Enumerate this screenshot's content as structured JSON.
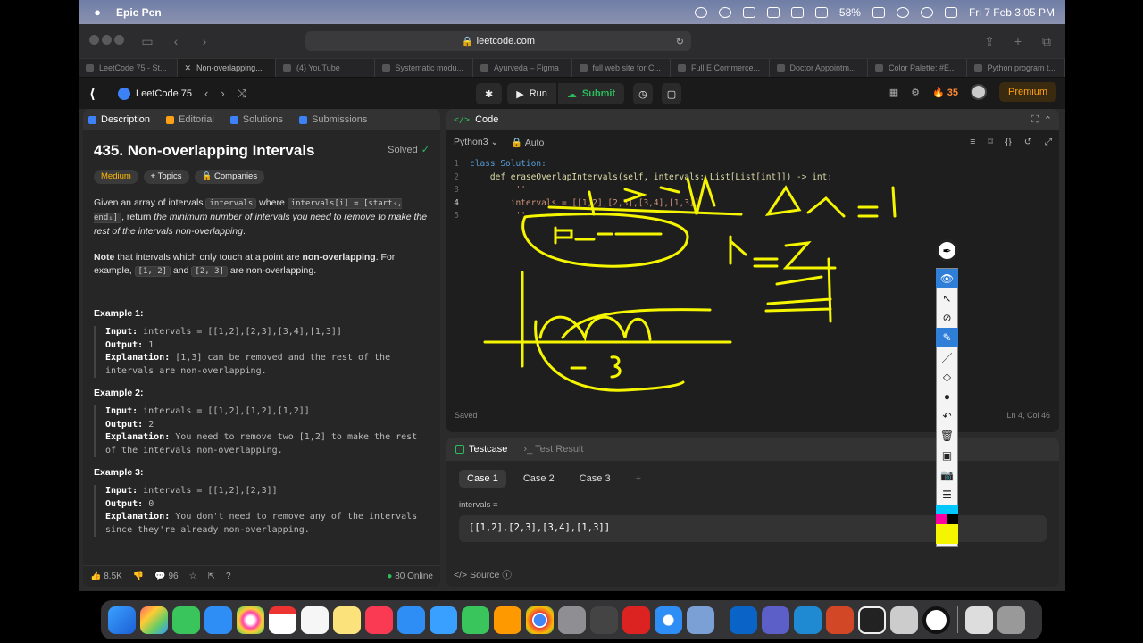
{
  "menubar": {
    "app": "Epic Pen",
    "battery": "58%",
    "clock": "Fri 7 Feb  3:05 PM"
  },
  "browser": {
    "url": "leetcode.com",
    "tabs": [
      "LeetCode 75 - St...",
      "Non-overlapping...",
      "(4) YouTube",
      "Systematic modu...",
      "Ayurveda – Figma",
      "full web site for C...",
      "Full E Commerce...",
      "Doctor Appointm...",
      "Color Palette: #E...",
      "Python program t..."
    ]
  },
  "lc": {
    "study_plan": "LeetCode 75",
    "run": "Run",
    "submit": "Submit",
    "streak": "35",
    "premium": "Premium"
  },
  "left": {
    "tabs": [
      "Description",
      "Editorial",
      "Solutions",
      "Submissions"
    ],
    "title": "435. Non-overlapping Intervals",
    "solved": "Solved",
    "difficulty": "Medium",
    "topics": "Topics",
    "companies": "Companies",
    "desc1a": "Given an array of intervals ",
    "desc1code1": "intervals",
    "desc1b": " where ",
    "desc1code2": "intervals[i] = [startᵢ, endᵢ]",
    "desc1c": ", return ",
    "desc1em": "the minimum number of intervals you need to remove to make the rest of the intervals non-overlapping",
    "desc1d": ".",
    "note_b": "Note",
    "note_a": " that intervals which only touch at a point are ",
    "note_bold": "non-overlapping",
    "note_c": ". For example, ",
    "note_code1": "[1, 2]",
    "note_and": " and ",
    "note_code2": "[2, 3]",
    "note_d": " are non-overlapping.",
    "examples": [
      {
        "h": "Example 1:",
        "input": "intervals = [[1,2],[2,3],[3,4],[1,3]]",
        "output": "1",
        "expl": "[1,3] can be removed and the rest of the intervals are non-overlapping."
      },
      {
        "h": "Example 2:",
        "input": "intervals = [[1,2],[1,2],[1,2]]",
        "output": "2",
        "expl": "You need to remove two [1,2] to make the rest of the intervals non-overlapping."
      },
      {
        "h": "Example 3:",
        "input": "intervals = [[1,2],[2,3]]",
        "output": "0",
        "expl": "You don't need to remove any of the intervals since they're already non-overlapping."
      }
    ],
    "lbl_input": "Input:",
    "lbl_output": "Output:",
    "lbl_expl": "Explanation:",
    "likes": "8.5K",
    "comments": "96",
    "online": "80 Online"
  },
  "code": {
    "header": "Code",
    "lang": "Python3",
    "auto": "Auto",
    "lines": [
      "class Solution:",
      "    def eraseOverlapIntervals(self, intervals: List[List[int]]) -> int:",
      "        '''",
      "        intervals = [[1,2],[2,3],[3,4],[1,3]]",
      "        '''"
    ],
    "saved": "Saved",
    "cursor": "Ln 4, Col 46"
  },
  "test": {
    "tab1": "Testcase",
    "tab2": "Test Result",
    "cases": [
      "Case 1",
      "Case 2",
      "Case 3"
    ],
    "label": "intervals =",
    "value": "[[1,2],[2,3],[3,4],[1,3]]",
    "source": "Source"
  },
  "colors": {
    "accent": "#ffa116",
    "green": "#2cbb5d",
    "ink": "#f5f500",
    "bg": "#1a1a1a"
  }
}
